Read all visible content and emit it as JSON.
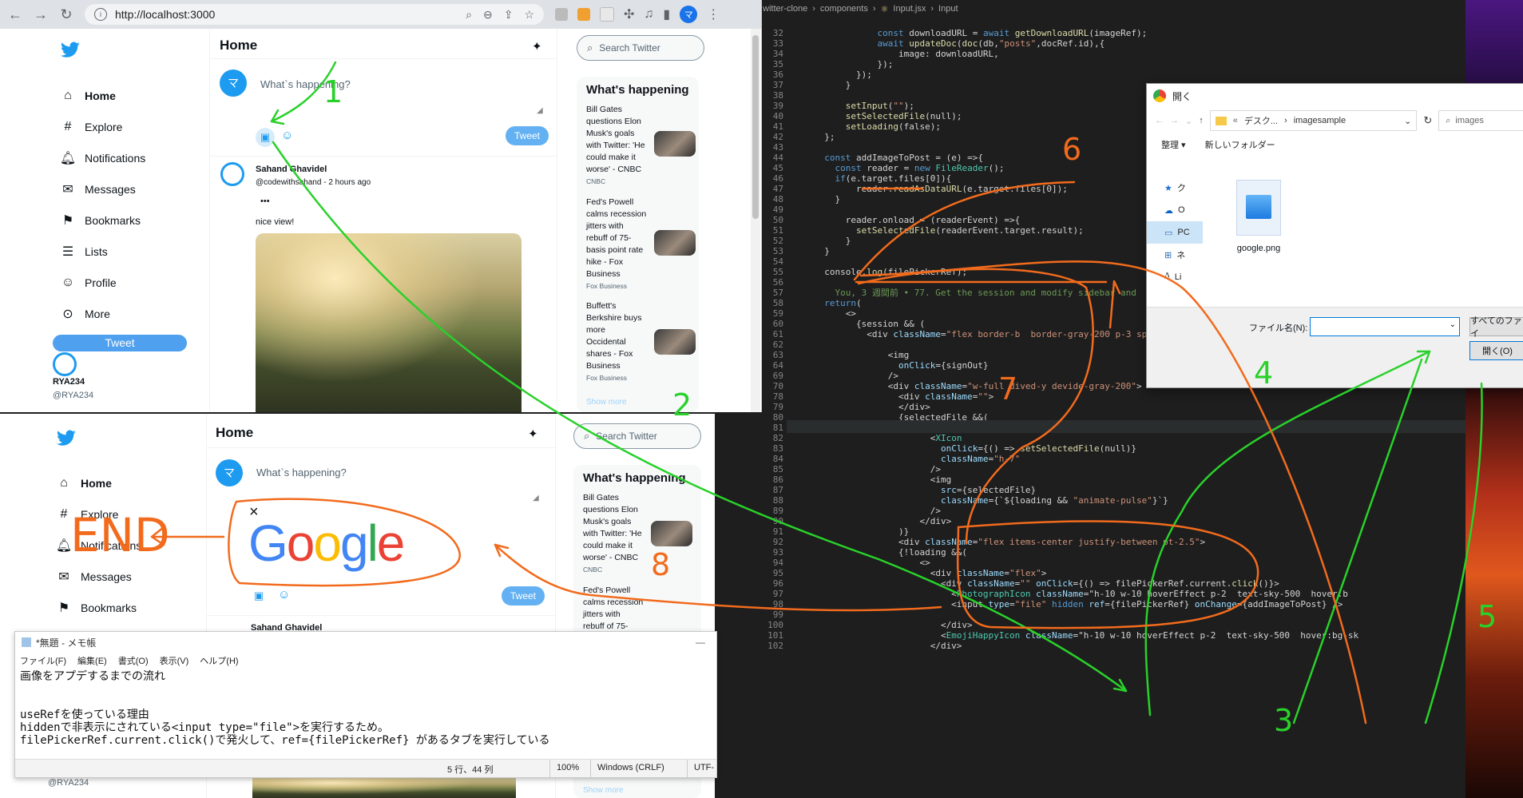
{
  "browser": {
    "url": "http://localhost:3000"
  },
  "twitter": {
    "home_title": "Home",
    "nav": [
      {
        "label": "Home",
        "icon": "house-icon"
      },
      {
        "label": "Explore",
        "icon": "hashtag-icon"
      },
      {
        "label": "Notifications",
        "icon": "bell-icon"
      },
      {
        "label": "Messages",
        "icon": "mail-icon"
      },
      {
        "label": "Bookmarks",
        "icon": "bookmark-icon"
      },
      {
        "label": "Lists",
        "icon": "list-icon"
      },
      {
        "label": "Profile",
        "icon": "person-icon"
      },
      {
        "label": "More",
        "icon": "more-circle-icon"
      }
    ],
    "sidebar_tweet_button": "Tweet",
    "account_name": "RYA234",
    "account_handle": "@RYA234",
    "composer_placeholder": "What`s happening?",
    "composer_tweet_button": "Tweet",
    "composer_avatar_letter": "マ",
    "post": {
      "author": "Sahand Ghavidel",
      "handle_time": "@codewithsahand - 2 hours ago",
      "more": "•••",
      "text": "nice view!"
    },
    "second_post_author": "Sahand Ghavidel",
    "search_placeholder": "Search Twitter",
    "whats_happening_title": "What's happening",
    "news": [
      {
        "lines": [
          "Bill Gates",
          "questions Elon",
          "Musk's goals",
          "with Twitter: 'He",
          "could make it",
          "worse' - CNBC"
        ],
        "source": "CNBC"
      },
      {
        "lines": [
          "Fed's Powell",
          "calms recession",
          "jitters with",
          "rebuff of 75-",
          "basis point rate",
          "hike - Fox",
          "Business"
        ],
        "source": "Fox Business"
      },
      {
        "lines": [
          "Buffett's",
          "Berkshire buys",
          "more",
          "Occidental",
          "shares - Fox",
          "Business"
        ],
        "source": "Fox Business"
      }
    ],
    "show_more": "Show more",
    "selected_image_text": "Google",
    "close_glyph": "×"
  },
  "notepad": {
    "title": "*無題 - メモ帳",
    "menu": [
      "ファイル(F)",
      "編集(E)",
      "書式(O)",
      "表示(V)",
      "ヘルプ(H)"
    ],
    "body": "画像をアプデするまでの流れ\n\n\nuseRefを使っている理由\nhiddenで非表示にされている<input type=\"file\">を実行するため。\nfilePickerRef.current.click()で発火して、ref={filePickerRef} があるタブを実行している",
    "status": [
      "5 行、44 列",
      "100%",
      "Windows (CRLF)",
      "UTF-"
    ]
  },
  "editor": {
    "breadcrumb": [
      "witter-clone",
      "components",
      "Input.jsx",
      "Input"
    ],
    "lines": [
      {
        "n": "32",
        "t": "            const downloadURL = await getDownloadURL(imageRef);"
      },
      {
        "n": "33",
        "t": "            await updateDoc(doc(db,\"posts\",docRef.id),{"
      },
      {
        "n": "34",
        "t": "                image: downloadURL,"
      },
      {
        "n": "35",
        "t": "            });"
      },
      {
        "n": "36",
        "t": "        });"
      },
      {
        "n": "37",
        "t": "      }"
      },
      {
        "n": "38",
        "t": ""
      },
      {
        "n": "39",
        "t": "      setInput(\"\");"
      },
      {
        "n": "40",
        "t": "      setSelectedFile(null);"
      },
      {
        "n": "41",
        "t": "      setLoading(false);"
      },
      {
        "n": "42",
        "t": "  };"
      },
      {
        "n": "43",
        "t": ""
      },
      {
        "n": "44",
        "t": "  const addImageToPost = (e) =>{"
      },
      {
        "n": "45",
        "t": "    const reader = new FileReader();"
      },
      {
        "n": "46",
        "t": "    if(e.target.files[0]){"
      },
      {
        "n": "47",
        "t": "        reader.readAsDataURL(e.target.files[0]);"
      },
      {
        "n": "48",
        "t": "    }"
      },
      {
        "n": "49",
        "t": ""
      },
      {
        "n": "50",
        "t": "      reader.onload = (readerEvent) =>{"
      },
      {
        "n": "51",
        "t": "        setSelectedFile(readerEvent.target.result);"
      },
      {
        "n": "52",
        "t": "      }"
      },
      {
        "n": "53",
        "t": "  }"
      },
      {
        "n": "54",
        "t": ""
      },
      {
        "n": "55",
        "t": "  console.log(filePickerRef);"
      },
      {
        "n": "56",
        "t": ""
      },
      {
        "n": "57",
        "t": "    You, 3 週間前 • 77. Get the session and modify sidebar and"
      },
      {
        "n": "58",
        "t": "  return("
      },
      {
        "n": "59",
        "t": "      <>"
      },
      {
        "n": "60",
        "t": "        {session && ("
      },
      {
        "n": "61",
        "t": "          <div className=\"flex border-b  border-gray-200 p-3 space-x-3\">"
      },
      {
        "n": "62",
        "t": ""
      },
      {
        "n": "63",
        "t": "              <img"
      },
      {
        "n": "64",
        "t": "                onClick={signOut}"
      },
      {
        "n": "69",
        "t": "              />"
      },
      {
        "n": "70",
        "t": "              <div className=\"w-full dived-y devide-gray-200\">"
      },
      {
        "n": "78",
        "t": "                <div className=\"\">"
      },
      {
        "n": "79",
        "t": "                </div>"
      },
      {
        "n": "80",
        "t": "                {selectedFile &&("
      },
      {
        "n": "81",
        "t": "                    <div className=\"relative\">"
      },
      {
        "n": "82",
        "t": "                      <XIcon"
      },
      {
        "n": "83",
        "t": "                        onClick={() => setSelectedFile(null)}"
      },
      {
        "n": "84",
        "t": "                        className=\"h-7\""
      },
      {
        "n": "85",
        "t": "                      />"
      },
      {
        "n": "86",
        "t": "                      <img"
      },
      {
        "n": "87",
        "t": "                        src={selectedFile}"
      },
      {
        "n": "88",
        "t": "                        className={`${loading && \"animate-pulse\"}`}"
      },
      {
        "n": "89",
        "t": "                      />"
      },
      {
        "n": "90",
        "t": "                    </div>"
      },
      {
        "n": "91",
        "t": "                )}"
      },
      {
        "n": "92",
        "t": "                <div className=\"flex items-center justify-between pt-2.5\">"
      },
      {
        "n": "93",
        "t": "                {!loading &&("
      },
      {
        "n": "94",
        "t": "                    <>"
      },
      {
        "n": "95",
        "t": "                      <div className=\"flex\">"
      },
      {
        "n": "96",
        "t": "                        <div className=\"\" onClick={() => filePickerRef.current.click()}>"
      },
      {
        "n": "97",
        "t": "                          <PhotographIcon className=\"h-10 w-10 hoverEffect p-2  text-sky-500  hover:b"
      },
      {
        "n": "98",
        "t": "                          <input type=\"file\" hidden ref={filePickerRef} onChange={addImageToPost} />"
      },
      {
        "n": "99",
        "t": ""
      },
      {
        "n": "100",
        "t": "                        </div>"
      },
      {
        "n": "101",
        "t": "                        <EmojiHappyIcon className=\"h-10 w-10 hoverEffect p-2  text-sky-500  hover:bg-sk"
      },
      {
        "n": "102",
        "t": "                      </div>"
      }
    ]
  },
  "dialog": {
    "title": "開く",
    "path": [
      "デスク...",
      "imagesample"
    ],
    "search_placeholder": "images",
    "organize": "整理 ▾",
    "new_folder": "新しいフォルダー",
    "left": [
      "ク",
      "O",
      "PC",
      "ネ",
      "Li"
    ],
    "file_name": "google.png",
    "filename_label": "ファイル名(N):",
    "filter": "すべてのファイ",
    "open_button": "開く(O)"
  },
  "annotations": {
    "numbers": [
      "1",
      "2",
      "3",
      "4",
      "5",
      "6",
      "7",
      "8"
    ],
    "end_text": "END",
    "green": "#29d12a",
    "orange": "#f26b1d"
  },
  "colors": {
    "twitter_blue": "#1d9bf0",
    "tweet_button": "#50a0f0"
  }
}
